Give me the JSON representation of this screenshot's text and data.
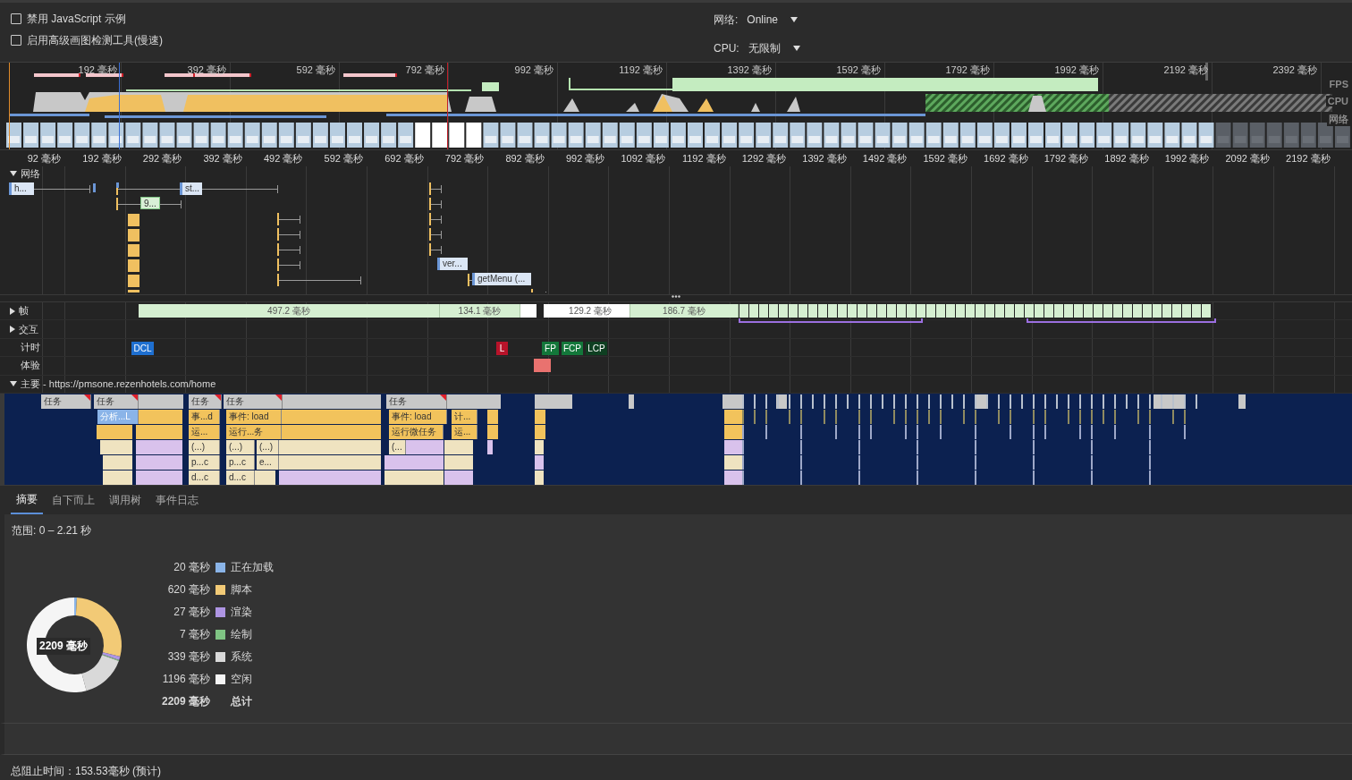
{
  "toolbar": {
    "checkboxes": [
      {
        "label": "禁用 JavaScript 示例",
        "checked": false
      },
      {
        "label": "启用高级画图检测工具(慢速)",
        "checked": false
      }
    ],
    "throttles": [
      {
        "label": "网络:",
        "value": "Online"
      },
      {
        "label": "CPU:",
        "value": "无限制"
      }
    ]
  },
  "overview": {
    "ruler": [
      "192 毫秒",
      "392 毫秒",
      "592 毫秒",
      "792 毫秒",
      "992 毫秒",
      "1192 毫秒",
      "1392 毫秒",
      "1592 毫秒",
      "1792 毫秒",
      "1992 毫秒",
      "2192 毫秒",
      "2392 毫秒"
    ],
    "lanes": [
      "FPS",
      "CPU",
      "网络"
    ]
  },
  "ruler": [
    "92 毫秒",
    "192 毫秒",
    "292 毫秒",
    "392 毫秒",
    "492 毫秒",
    "592 毫秒",
    "692 毫秒",
    "792 毫秒",
    "892 毫秒",
    "992 毫秒",
    "1092 毫秒",
    "1192 毫秒",
    "1292 毫秒",
    "1392 毫秒",
    "1492 毫秒",
    "1592 毫秒",
    "1692 毫秒",
    "1792 毫秒",
    "1892 毫秒",
    "1992 毫秒",
    "2092 毫秒",
    "2192 毫秒"
  ],
  "network": {
    "title": "网络",
    "expanded": true,
    "requests": [
      {
        "label": "h..."
      },
      {
        "label": "st..."
      },
      {
        "label": "9..."
      },
      {
        "label": "ver..."
      },
      {
        "label": "getMenu (..."
      }
    ]
  },
  "tracks": [
    {
      "title": "帧",
      "expanded": false
    },
    {
      "title": "交互",
      "expanded": false
    },
    {
      "title": "计时"
    },
    {
      "title": "体验"
    }
  ],
  "frames": [
    {
      "label": "497.2 毫秒",
      "color": "#d5efd1"
    },
    {
      "label": "134.1 毫秒",
      "color": "#d5efd1"
    },
    {
      "label": "129.2 毫秒",
      "color": "#ffffff"
    },
    {
      "label": "186.7 毫秒",
      "color": "#d5efd1"
    }
  ],
  "timings": [
    {
      "label": "DCL",
      "color": "#1e6fd0"
    },
    {
      "label": "L",
      "color": "#b8132a"
    },
    {
      "label": "FP",
      "color": "#13773a"
    },
    {
      "label": "FCP",
      "color": "#13773a"
    },
    {
      "label": "LCP",
      "color": "#0e3f21"
    }
  ],
  "main": {
    "title": "主要 - https://pmsone.rezenhotels.com/home",
    "expanded": true,
    "blocks": [
      {
        "label": "任务",
        "kind": "task"
      },
      {
        "label": "任务",
        "kind": "task",
        "children": [
          {
            "label": "分析...L",
            "kind": "parse"
          }
        ]
      },
      {
        "label": "任务",
        "kind": "task",
        "children": [
          {
            "label": "事...d",
            "kind": "event",
            "children": [
              {
                "label": "运...",
                "kind": "event",
                "children": [
                  {
                    "label": "(...)",
                    "kind": "call",
                    "children": [
                      {
                        "label": "p...c",
                        "kind": "call",
                        "children": [
                          {
                            "label": "d...c",
                            "kind": "call"
                          }
                        ]
                      }
                    ]
                  }
                ]
              }
            ]
          }
        ]
      },
      {
        "label": "任务",
        "kind": "task",
        "children": [
          {
            "label": "事件: load",
            "kind": "event",
            "children": [
              {
                "label": "运行...务",
                "kind": "event",
                "children": [
                  {
                    "label": "(...)",
                    "kind": "call",
                    "children": [
                      {
                        "label": "p...c",
                        "kind": "call",
                        "children": [
                          {
                            "label": "d...c",
                            "kind": "call"
                          }
                        ]
                      }
                    ]
                  },
                  {
                    "label": "(...)",
                    "kind": "call",
                    "children": [
                      {
                        "label": "e...",
                        "kind": "call"
                      }
                    ]
                  }
                ]
              }
            ]
          }
        ]
      },
      {
        "label": "任务",
        "kind": "task",
        "children": [
          {
            "label": "事件: load",
            "kind": "event",
            "children": [
              {
                "label": "运行微任务",
                "kind": "event",
                "children": [
                  {
                    "label": "(...",
                    "kind": "call"
                  }
                ]
              }
            ]
          },
          {
            "label": "计...",
            "kind": "event",
            "children": [
              {
                "label": "运...",
                "kind": "event"
              }
            ]
          }
        ]
      }
    ]
  },
  "details": {
    "tabs": [
      {
        "label": "摘要",
        "selected": true
      },
      {
        "label": "自下而上",
        "selected": false
      },
      {
        "label": "调用树",
        "selected": false
      },
      {
        "label": "事件日志",
        "selected": false
      }
    ],
    "range": "范围: 0 – 2.21 秒",
    "center": "2209 毫秒",
    "legend": [
      {
        "value": "20 毫秒",
        "label": "正在加载",
        "color": "#8ab4e8"
      },
      {
        "value": "620 毫秒",
        "label": "脚本",
        "color": "#f2ca76"
      },
      {
        "value": "27 毫秒",
        "label": "渲染",
        "color": "#ae95e3"
      },
      {
        "value": "7 毫秒",
        "label": "绘制",
        "color": "#7fc383"
      },
      {
        "value": "339 毫秒",
        "label": "系统",
        "color": "#d9d9d9"
      },
      {
        "value": "1196 毫秒",
        "label": "空闲",
        "color": "#f5f5f5"
      }
    ],
    "total": {
      "value": "2209 毫秒",
      "label": "总计"
    },
    "chart_data": {
      "type": "donut",
      "values": [
        0.9,
        28.07,
        1.22,
        0.32,
        15.35,
        54.14
      ]
    }
  },
  "status_bar": "总阻止时间：153.53毫秒 (预计)"
}
